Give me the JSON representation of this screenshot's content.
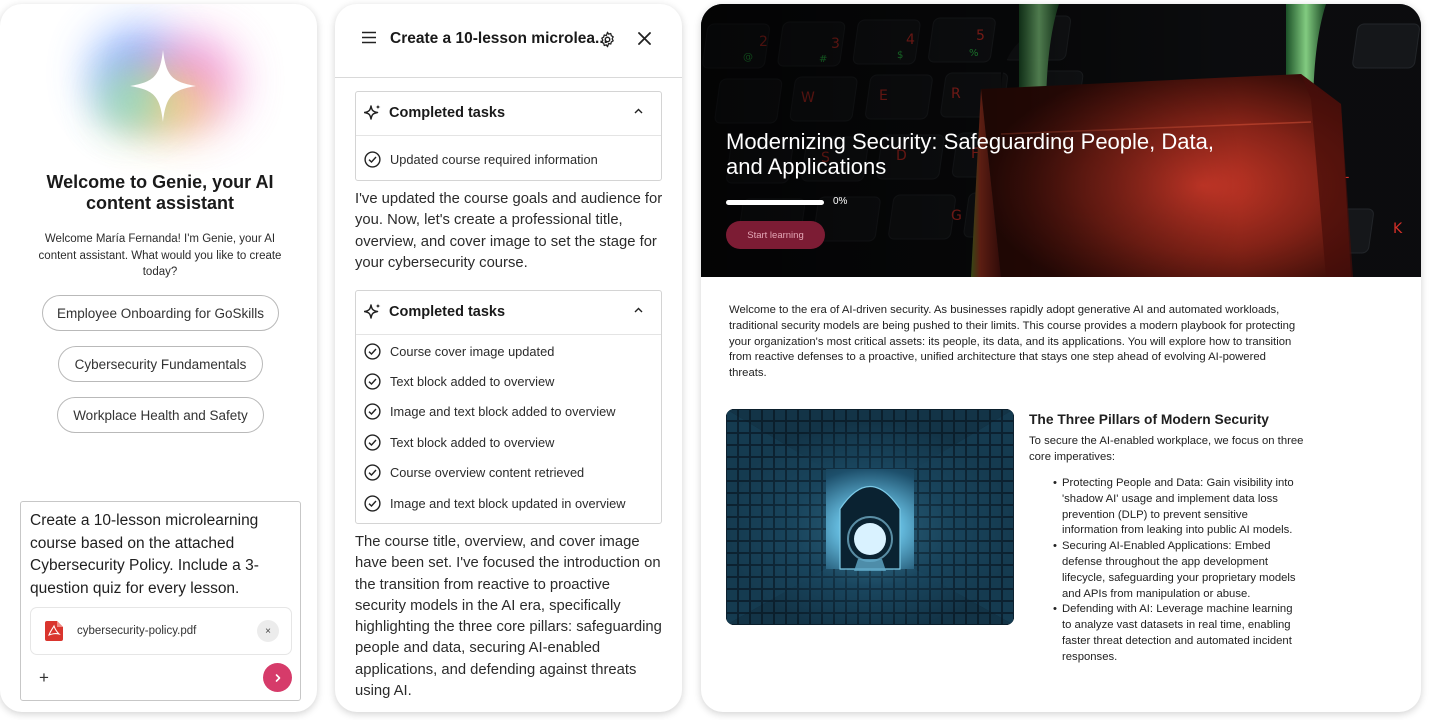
{
  "genie": {
    "welcome_title": "Welcome to Genie, your AI content assistant",
    "welcome_sub": "Welcome María Fernanda! I'm Genie, your AI content assistant. What would you like to create today?",
    "suggestions": [
      "Employee Onboarding for GoSkills",
      "Cybersecurity Fundamentals",
      "Workplace Health and Safety"
    ],
    "composer_text": "Create a 10-lesson microlearning course based on the attached Cybersecurity Policy. Include a 3-question quiz for every lesson.",
    "attachment_name": "cybersecurity-policy.pdf",
    "remove_attachment_label": "×",
    "add_label": "+",
    "accent_color": "#d63b6a"
  },
  "chat": {
    "title": "Create a 10-lesson microlea...",
    "task_group_1": {
      "label": "Completed tasks",
      "tasks": [
        "Updated course required information"
      ]
    },
    "message_1": "I've updated the course goals and audience for you. Now, let's create a professional title, overview, and cover image to set the stage for your cybersecurity course.",
    "task_group_2": {
      "label": "Completed tasks",
      "tasks": [
        "Course cover image updated",
        "Text block added to overview",
        "Image and text block added to overview",
        "Text block added to overview",
        "Course overview content retrieved",
        "Image and text block updated in overview"
      ]
    },
    "message_2": "The course title, overview, and cover image have been set. I've focused the introduction on the transition from reactive to proactive security models in the AI era, specifically highlighting the three core pillars: safeguarding people and data, securing AI-enabled applications, and defending against threats using AI."
  },
  "course": {
    "title": "Modernizing Security: Safeguarding People, Data, and Applications",
    "progress": 0,
    "progress_text": "0%",
    "start_label": "Start learning",
    "intro": "Welcome to the era of AI-driven security. As businesses rapidly adopt generative AI and automated workloads, traditional security models are being pushed to their limits. This course provides a modern playbook for protecting your organization's most critical assets: its people, its data, and its applications. You will explore how to transition from reactive defenses to a proactive, unified architecture that stays one step ahead of evolving AI-powered threats.",
    "pillars_title": "The Three Pillars of Modern Security",
    "pillars_sub": "To secure the AI-enabled workplace, we focus on three core imperatives:",
    "pillars": [
      "Protecting People and Data: Gain visibility into 'shadow AI' usage and implement data loss prevention (DLP) to prevent sensitive information from leaking into public AI models.",
      "Securing AI-Enabled Applications: Embed defense throughout the app development lifecycle, safeguarding your proprietary models and APIs from manipulation or abuse.",
      "Defending with AI: Leverage machine learning to analyze vast datasets in real time, enabling faster threat detection and automated incident responses."
    ]
  }
}
